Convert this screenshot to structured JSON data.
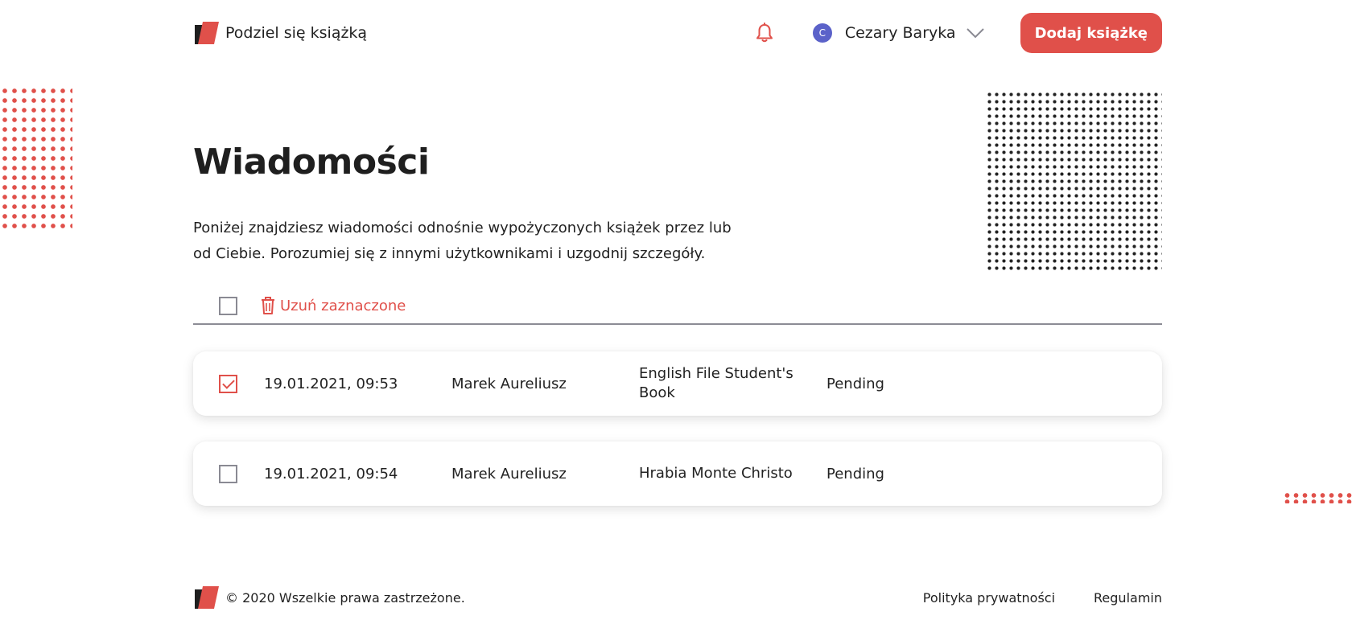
{
  "brand": {
    "name": "Podziel się książką",
    "accent_color": "#e0504a"
  },
  "header": {
    "notification_icon": "bell-icon",
    "user": {
      "initial": "C",
      "name": "Cezary Baryka",
      "avatar_color": "#5b62c9"
    },
    "add_book_label": "Dodaj książkę"
  },
  "main": {
    "title": "Wiadomości",
    "description": "Poniżej znajdziesz wiadomości odnośnie wypożyczonych książek przez lub od Ciebie. Porozumiej się z innymi użytkownikami i uzgodnij szczegóły.",
    "delete_selected_label": "Uzuń zaznaczone",
    "messages": [
      {
        "checked": true,
        "date": "19.01.2021, 09:53",
        "user": "Marek Aureliusz",
        "book": "English File Student's Book",
        "status": "Pending"
      },
      {
        "checked": false,
        "date": "19.01.2021, 09:54",
        "user": "Marek Aureliusz",
        "book": "Hrabia Monte Christo",
        "status": "Pending"
      }
    ]
  },
  "footer": {
    "copyright": "© 2020 Wszelkie prawa zastrzeżone.",
    "links": [
      "Polityka prywatności",
      "Regulamin"
    ]
  }
}
